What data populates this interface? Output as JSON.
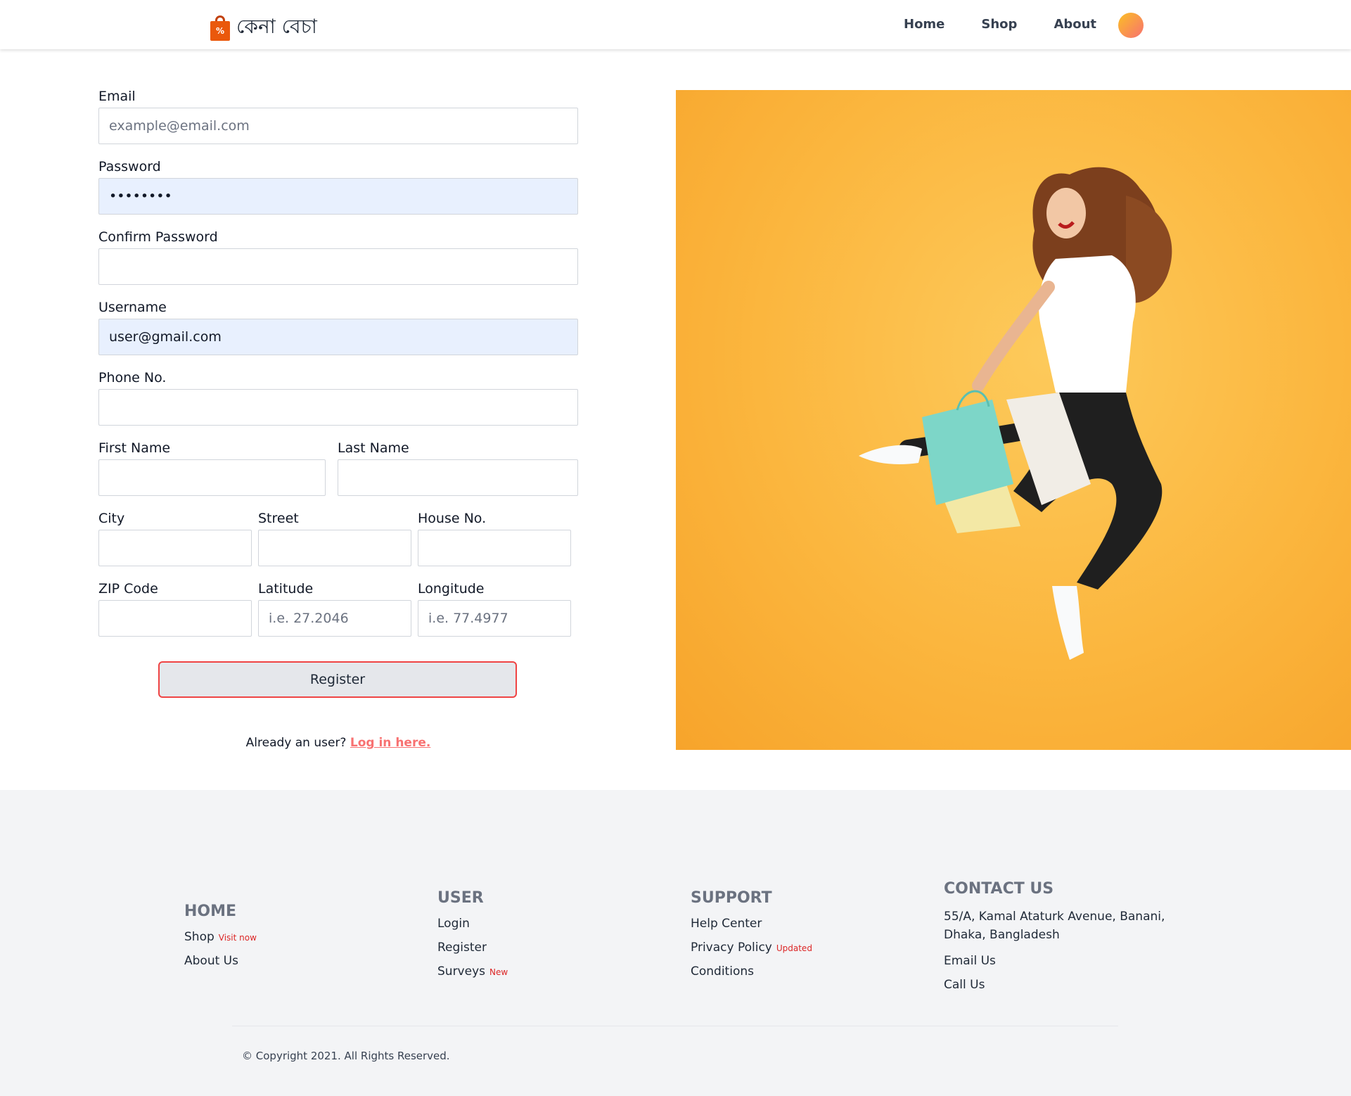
{
  "header": {
    "brand": "কেনা বেচা",
    "logo_badge": "%",
    "nav": [
      "Home",
      "Shop",
      "About"
    ]
  },
  "form": {
    "email": {
      "label": "Email",
      "placeholder": "example@email.com",
      "value": ""
    },
    "password": {
      "label": "Password",
      "value": "••••••••"
    },
    "confirm_password": {
      "label": "Confirm Password",
      "value": ""
    },
    "username": {
      "label": "Username",
      "value": "user@gmail.com"
    },
    "phone": {
      "label": "Phone No.",
      "value": ""
    },
    "first_name": {
      "label": "First Name",
      "value": ""
    },
    "last_name": {
      "label": "Last Name",
      "value": ""
    },
    "city": {
      "label": "City",
      "value": ""
    },
    "street": {
      "label": "Street",
      "value": ""
    },
    "house_no": {
      "label": "House No.",
      "value": ""
    },
    "zip": {
      "label": "ZIP Code",
      "value": ""
    },
    "latitude": {
      "label": "Latitude",
      "placeholder": "i.e. 27.2046",
      "value": ""
    },
    "longitude": {
      "label": "Longitude",
      "placeholder": "i.e. 77.4977",
      "value": ""
    },
    "register_label": "Register",
    "login_prompt": "Already an user?",
    "login_link": "Log in here."
  },
  "colors": {
    "accent": "#ef4444",
    "hero_bg": "#fbb63e",
    "autofill_bg": "#e8f0fe",
    "footer_bg": "#f3f4f6"
  },
  "footer": {
    "home": {
      "title": "HOME",
      "links": [
        {
          "label": "Shop",
          "badge": "Visit now"
        },
        {
          "label": "About Us",
          "badge": ""
        }
      ]
    },
    "user": {
      "title": "USER",
      "links": [
        {
          "label": "Login",
          "badge": ""
        },
        {
          "label": "Register",
          "badge": ""
        },
        {
          "label": "Surveys",
          "badge": "New"
        }
      ]
    },
    "support": {
      "title": "SUPPORT",
      "links": [
        {
          "label": "Help Center",
          "badge": ""
        },
        {
          "label": "Privacy Policy",
          "badge": "Updated"
        },
        {
          "label": "Conditions",
          "badge": ""
        }
      ]
    },
    "contact": {
      "title": "CONTACT US",
      "address_line1": "55/A, Kamal Ataturk Avenue, Banani,",
      "address_line2": "Dhaka, Bangladesh",
      "links": [
        "Email Us",
        "Call Us"
      ]
    },
    "copyright": "© Copyright 2021. All Rights Reserved."
  }
}
